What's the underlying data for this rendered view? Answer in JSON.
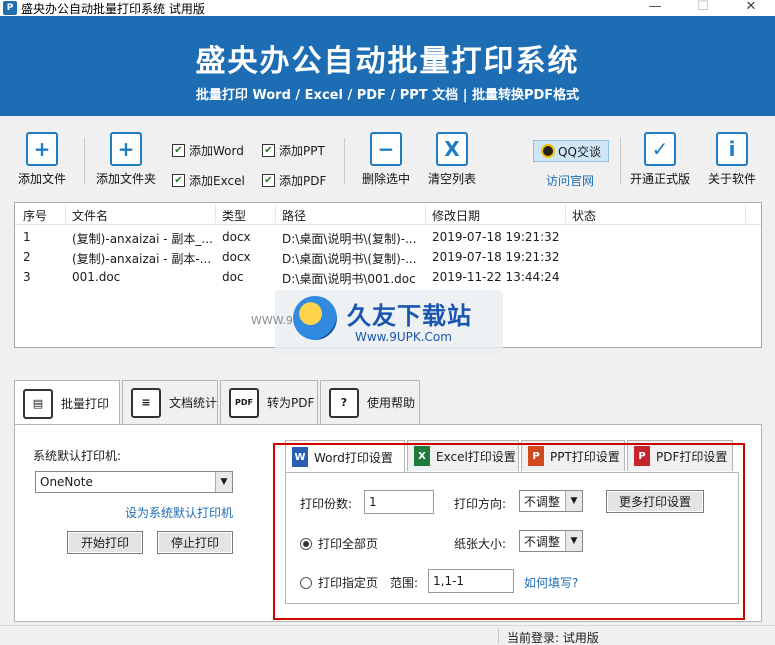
{
  "window": {
    "title": "盛央办公自动批量打印系统 试用版",
    "min": "—",
    "max": "☐",
    "close": "✕"
  },
  "banner": {
    "title": "盛央办公自动批量打印系统",
    "subtitle": "批量打印 Word / Excel / PDF / PPT 文档  |  批量转换PDF格式"
  },
  "toolbar": {
    "add_file": "添加文件",
    "add_folder": "添加文件夹",
    "chk_word": "添加Word",
    "chk_excel": "添加Excel",
    "chk_ppt": "添加PPT",
    "chk_pdf": "添加PDF",
    "delete_selected": "删除选中",
    "clear_list": "清空列表",
    "qq": "QQ交谈",
    "website": "访问官网",
    "activate": "开通正式版",
    "about": "关于软件"
  },
  "filelist": {
    "columns": [
      "序号",
      "文件名",
      "类型",
      "路径",
      "修改日期",
      "状态"
    ],
    "rows": [
      [
        "1",
        "(复制)-anxaizai - 副本_...",
        "docx",
        "D:\\桌面\\说明书\\(复制)-...",
        "2019-07-18 19:21:32",
        ""
      ],
      [
        "2",
        "(复制)-anxaizai - 副本-...",
        "docx",
        "D:\\桌面\\说明书\\(复制)-...",
        "2019-07-18 19:21:32",
        ""
      ],
      [
        "3",
        "001.doc",
        "doc",
        "D:\\桌面\\说明书\\001.doc",
        "2019-11-22 13:44:24",
        ""
      ]
    ]
  },
  "watermark": {
    "brand": "久友下载站",
    "url": "Www.9UPK.Com",
    "left": "WWW.9U"
  },
  "tabs": [
    "批量打印",
    "文档统计",
    "转为PDF",
    "使用帮助"
  ],
  "print": {
    "printer_label": "系统默认打印机:",
    "printer_value": "OneNote",
    "set_default": "设为系统默认打印机",
    "start": "开始打印",
    "stop": "停止打印"
  },
  "subtabs": [
    "Word打印设置",
    "Excel打印设置",
    "PPT打印设置",
    "PDF打印设置"
  ],
  "word_settings": {
    "copies_label": "打印份数:",
    "copies_value": "1",
    "direction_label": "打印方向:",
    "direction_value": "不调整",
    "more": "更多打印设置",
    "all_pages": "打印全部页",
    "paper_label": "纸张大小:",
    "paper_value": "不调整",
    "specific_pages": "打印指定页",
    "range_label": "范围:",
    "range_value": "1,1-1",
    "howto": "如何填写?"
  },
  "status": {
    "login": "当前登录: 试用版"
  },
  "colors": {
    "banner": "#1c6db3",
    "accent": "#1f7dc2",
    "highlight_box": "#d00000"
  }
}
